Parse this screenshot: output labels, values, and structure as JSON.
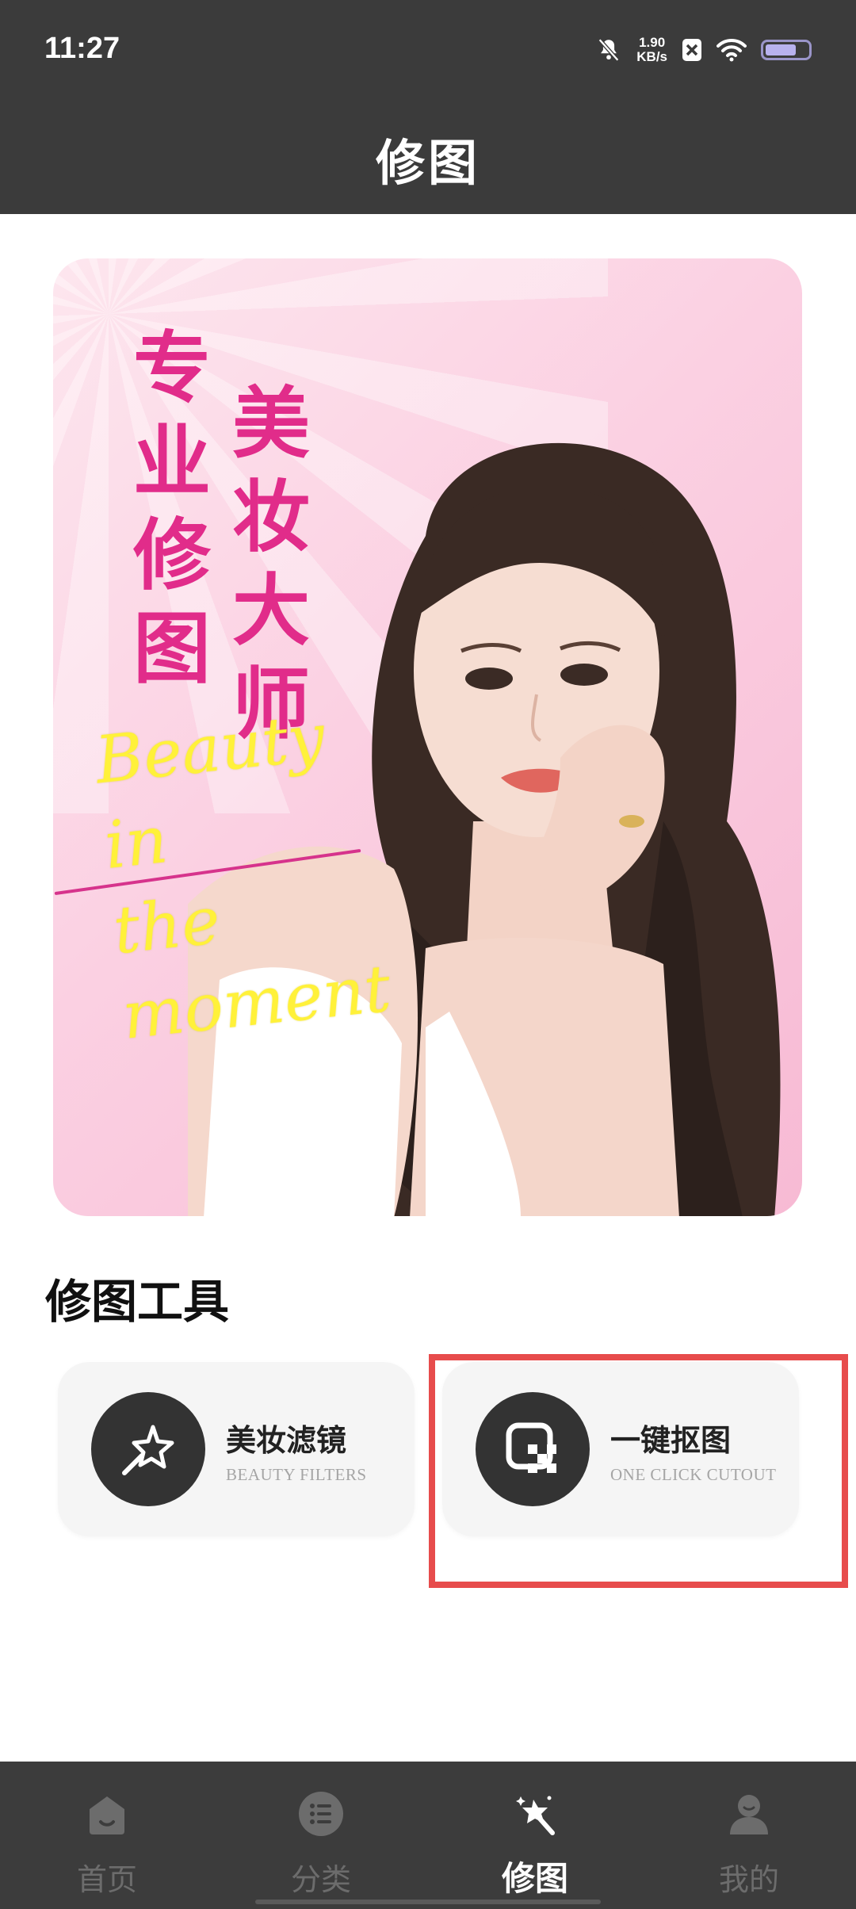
{
  "status_bar": {
    "time": "11:27",
    "net_speed_value": "1.90",
    "net_speed_unit": "KB/s",
    "battery_level": 0.75
  },
  "header": {
    "title": "修图"
  },
  "banner": {
    "col1": [
      "专",
      "业",
      "修",
      "图"
    ],
    "col2": [
      "美",
      "妆",
      "大",
      "师"
    ],
    "script_line1": "Beauty in",
    "script_line2": "the moment"
  },
  "section": {
    "title": "修图工具"
  },
  "tools": [
    {
      "title": "美妆滤镜",
      "subtitle": "BEAUTY FILTERS",
      "icon": "magic-wand-star-icon"
    },
    {
      "title": "一键抠图",
      "subtitle": "ONE CLICK CUTOUT",
      "icon": "cutout-icon"
    }
  ],
  "tabs": [
    {
      "label": "首页",
      "icon": "home-icon",
      "active": false
    },
    {
      "label": "分类",
      "icon": "list-icon",
      "active": false
    },
    {
      "label": "修图",
      "icon": "magic-wand-icon",
      "active": true
    },
    {
      "label": "我的",
      "icon": "user-icon",
      "active": false
    }
  ],
  "colors": {
    "header_bg": "#3b3b3b",
    "banner_text": "#e12c8a",
    "script_text": "#fff13a",
    "highlight": "#e74c4c",
    "tab_active": "#ffffff",
    "tab_inactive": "#6c6c6c"
  }
}
